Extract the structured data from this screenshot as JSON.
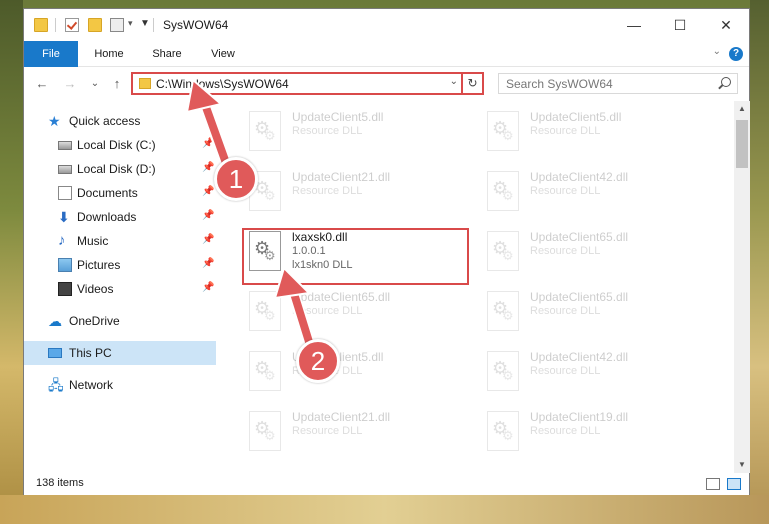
{
  "window": {
    "title": "SysWOW64",
    "controls": {
      "minimize": "—",
      "maximize": "☐",
      "close": "✕"
    }
  },
  "ribbon": {
    "tabs": [
      "File",
      "Home",
      "Share",
      "View"
    ],
    "help": "?",
    "collapse": "⌄"
  },
  "nav": {
    "back": "←",
    "forward": "→",
    "recent": "⌄",
    "up": "↑",
    "address": "C:\\Windows\\SysWOW64",
    "address_dropdown": "⌄",
    "refresh": "↻",
    "search_placeholder": "Search SysWOW64"
  },
  "navpane": {
    "quick_access": "Quick access",
    "items": [
      {
        "label": "Local Disk (C:)",
        "icon": "drive-icon",
        "pinned": true
      },
      {
        "label": "Local Disk (D:)",
        "icon": "drive-icon",
        "pinned": true
      },
      {
        "label": "Documents",
        "icon": "documents-icon",
        "pinned": true
      },
      {
        "label": "Downloads",
        "icon": "downloads-icon",
        "pinned": true
      },
      {
        "label": "Music",
        "icon": "music-icon",
        "pinned": true
      },
      {
        "label": "Pictures",
        "icon": "pictures-icon",
        "pinned": true
      },
      {
        "label": "Videos",
        "icon": "videos-icon",
        "pinned": true
      }
    ],
    "onedrive": "OneDrive",
    "this_pc": "This PC",
    "network": "Network",
    "pin_glyph": "📌"
  },
  "files": {
    "left": [
      {
        "name": "UpdateClient5.dll",
        "type": "Resource DLL"
      },
      {
        "name": "UpdateClient21.dll",
        "type": "Resource DLL"
      },
      {
        "name": "lxaxsk0.dll",
        "version": "1.0.0.1",
        "type": "lx1skn0 DLL"
      },
      {
        "name": "UpdateClient65.dll",
        "type": "Resource DLL"
      },
      {
        "name": "UpdateClient5.dll",
        "type": "Resource DLL"
      },
      {
        "name": "UpdateClient21.dll",
        "type": "Resource DLL"
      }
    ],
    "right": [
      {
        "name": "UpdateClient5.dll",
        "type": "Resource DLL"
      },
      {
        "name": "UpdateClient42.dll",
        "type": "Resource DLL"
      },
      {
        "name": "UpdateClient65.dll",
        "type": "Resource DLL"
      },
      {
        "name": "UpdateClient65.dll",
        "type": "Resource DLL"
      },
      {
        "name": "UpdateClient42.dll",
        "type": "Resource DLL"
      },
      {
        "name": "UpdateClient19.dll",
        "type": "Resource DLL"
      }
    ]
  },
  "status": {
    "item_count": "138 items"
  },
  "callouts": [
    "1",
    "2"
  ],
  "colors": {
    "accent": "#1979ca",
    "highlight": "#d94a4a",
    "arrow": "#e05a5a",
    "selected": "#cce4f7"
  }
}
